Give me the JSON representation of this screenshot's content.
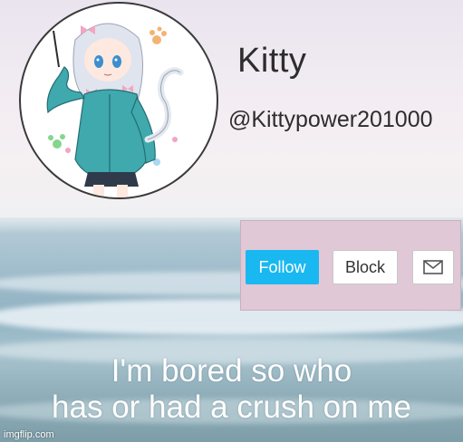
{
  "profile": {
    "display_name": "Kitty",
    "username": "@Kittypower201000"
  },
  "actions": {
    "follow_label": "Follow",
    "block_label": "Block",
    "message_icon": "envelope-icon"
  },
  "caption": {
    "line1": "I'm bored so who",
    "line2": "has or had a crush on me"
  },
  "watermark": "imgflip.com",
  "colors": {
    "follow_button": "#19b8f0",
    "panel_background": "#e0c8d6"
  }
}
